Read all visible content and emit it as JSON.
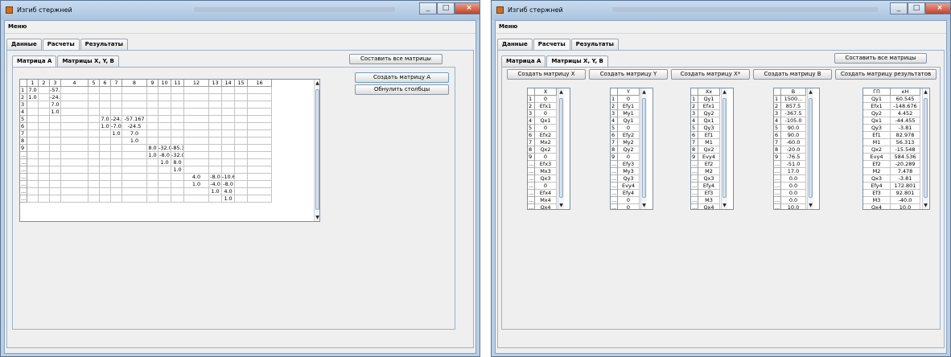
{
  "left": {
    "title": "Изгиб стержней",
    "menu": "Меню",
    "tabs": [
      "Данные",
      "Расчеты",
      "Результаты"
    ],
    "subtabs": [
      "Матрица A",
      "Матрицы X, Y, B"
    ],
    "btn_compose_all": "Составить все матрицы",
    "btn_create_a": "Создать матрицу А",
    "btn_zero_cols": "Обнулить столбцы",
    "matrix": {
      "headers": [
        "",
        "1",
        "2",
        "3",
        "4",
        "5",
        "6",
        "7",
        "8",
        "9",
        "10",
        "11",
        "12",
        "13",
        "14",
        "15",
        "16"
      ],
      "rows": [
        [
          "1",
          "7.0",
          "",
          "-57.167",
          "",
          "",
          "",
          "",
          "",
          "",
          "",
          "",
          "",
          "",
          "",
          ""
        ],
        [
          "2",
          "1.0",
          "",
          "-24.5",
          "",
          "",
          "",
          "",
          "",
          "",
          "",
          "",
          "",
          "",
          "",
          ""
        ],
        [
          "3",
          "",
          "",
          "7.0",
          "",
          "",
          "",
          "",
          "",
          "",
          "",
          "",
          "",
          "",
          "",
          ""
        ],
        [
          "4",
          "",
          "",
          "1.0",
          "",
          "",
          "",
          "",
          "",
          "",
          "",
          "",
          "",
          "",
          "",
          ""
        ],
        [
          "5",
          "",
          "",
          "",
          "",
          "",
          "7.0",
          "-24.5",
          "-57.167",
          "",
          "",
          "",
          "",
          "",
          "",
          ""
        ],
        [
          "6",
          "",
          "",
          "",
          "",
          "",
          "1.0",
          "-7.0",
          "-24.5",
          "",
          "",
          "",
          "",
          "",
          "",
          ""
        ],
        [
          "7",
          "",
          "",
          "",
          "",
          "",
          "",
          "1.0",
          "7.0",
          "",
          "",
          "",
          "",
          "",
          "",
          ""
        ],
        [
          "8",
          "",
          "",
          "",
          "",
          "",
          "",
          "",
          "1.0",
          "",
          "",
          "",
          "",
          "",
          "",
          ""
        ],
        [
          "9",
          "",
          "",
          "",
          "",
          "",
          "",
          "",
          "",
          "8.0",
          "-32.0",
          "-85.333",
          "",
          "",
          "",
          ""
        ],
        [
          "...",
          "",
          "",
          "",
          "",
          "",
          "",
          "",
          "",
          "1.0",
          "-8.0",
          "-32.0",
          "",
          "",
          "",
          ""
        ],
        [
          "...",
          "",
          "",
          "",
          "",
          "",
          "",
          "",
          "",
          "",
          "1.0",
          "8.0",
          "",
          "",
          "",
          ""
        ],
        [
          "...",
          "",
          "",
          "",
          "",
          "",
          "",
          "",
          "",
          "",
          "",
          "1.0",
          "",
          "",
          "",
          ""
        ],
        [
          "...",
          "",
          "",
          "",
          "",
          "",
          "",
          "",
          "",
          "",
          "",
          "",
          "4.0",
          "-8.0",
          "-10.6",
          ""
        ],
        [
          "...",
          "",
          "",
          "",
          "",
          "",
          "",
          "",
          "",
          "",
          "",
          "",
          "1.0",
          "-4.0",
          "-8.0",
          ""
        ],
        [
          "...",
          "",
          "",
          "",
          "",
          "",
          "",
          "",
          "",
          "",
          "",
          "",
          "",
          "1.0",
          "4.0",
          ""
        ],
        [
          "...",
          "",
          "",
          "",
          "",
          "",
          "",
          "",
          "",
          "",
          "",
          "",
          "",
          "",
          "1.0",
          ""
        ]
      ]
    }
  },
  "right": {
    "title": "Изгиб стержней",
    "menu": "Меню",
    "tabs": [
      "Данные",
      "Расчеты",
      "Результаты"
    ],
    "subtabs": [
      "Матрица A",
      "Матрицы X, Y, B"
    ],
    "btn_compose_all": "Составить все матрицы",
    "buttons": [
      "Создать матрицу X",
      "Создать матрицу Y",
      "Создать матрицу X*",
      "Создать матрицу B",
      "Создать матрицу результатов"
    ],
    "tables": [
      {
        "header": "X",
        "rownum": [
          "1",
          "2",
          "3",
          "4",
          "5",
          "6",
          "7",
          "8",
          "9",
          "...",
          "...",
          "...",
          "...",
          "...",
          "...",
          "..."
        ],
        "values": [
          "0",
          "Efx1",
          "0",
          "Qx1",
          "0",
          "Efx2",
          "Mx2",
          "Qx2",
          "0",
          "Efx3",
          "Mx3",
          "Qx3",
          "0",
          "Efx4",
          "Mx4",
          "Qx4"
        ]
      },
      {
        "header": "Y",
        "rownum": [
          "1",
          "2",
          "3",
          "4",
          "5",
          "6",
          "7",
          "8",
          "9",
          "...",
          "...",
          "...",
          "...",
          "...",
          "...",
          "..."
        ],
        "values": [
          "0",
          "Efy1",
          "My1",
          "Qy1",
          "0",
          "Efy2",
          "My2",
          "Qy2",
          "0",
          "Efy3",
          "My3",
          "Qy3",
          "Evy4",
          "Efy4",
          "0",
          "0"
        ]
      },
      {
        "header": "Xx",
        "rownum": [
          "1",
          "2",
          "3",
          "4",
          "5",
          "6",
          "7",
          "8",
          "9",
          "...",
          "...",
          "...",
          "...",
          "...",
          "...",
          "..."
        ],
        "values": [
          "Qy1",
          "Efx1",
          "Qy2",
          "Qx1",
          "Qy3",
          "Ef1",
          "M1",
          "Qx2",
          "Evy4",
          "Ef2",
          "M2",
          "Qx3",
          "Efy4",
          "Ef3",
          "M3",
          "Qx4"
        ]
      },
      {
        "header": "B",
        "rownum": [
          "1",
          "2",
          "3",
          "4",
          "5",
          "6",
          "7",
          "8",
          "9",
          "...",
          "...",
          "...",
          "...",
          "...",
          "...",
          "..."
        ],
        "values": [
          "1500...",
          "857.5",
          "-367.5",
          "-105.0",
          "90.0",
          "90.0",
          "-60.0",
          "-20.0",
          "-76.5",
          "-51.0",
          "17.0",
          "0.0",
          "0.0",
          "0.0",
          "0.0",
          "10.0"
        ]
      }
    ],
    "results": {
      "headers": [
        "ГП",
        "кН"
      ],
      "rows": [
        [
          "Qy1",
          "60.545"
        ],
        [
          "Efx1",
          "-148.676"
        ],
        [
          "Qy2",
          "4.452"
        ],
        [
          "Qx1",
          "-44.455"
        ],
        [
          "Qy3",
          "-3.81"
        ],
        [
          "Ef1",
          "82.978"
        ],
        [
          "M1",
          "56.313"
        ],
        [
          "Qx2",
          "-15.548"
        ],
        [
          "Evy4",
          "584.536"
        ],
        [
          "Ef2",
          "-20.289"
        ],
        [
          "M2",
          "7.478"
        ],
        [
          "Qx3",
          "-3.81"
        ],
        [
          "Efy4",
          "172.801"
        ],
        [
          "Ef3",
          "92.801"
        ],
        [
          "M3",
          "-40.0"
        ],
        [
          "Qx4",
          "10.0"
        ]
      ]
    }
  }
}
